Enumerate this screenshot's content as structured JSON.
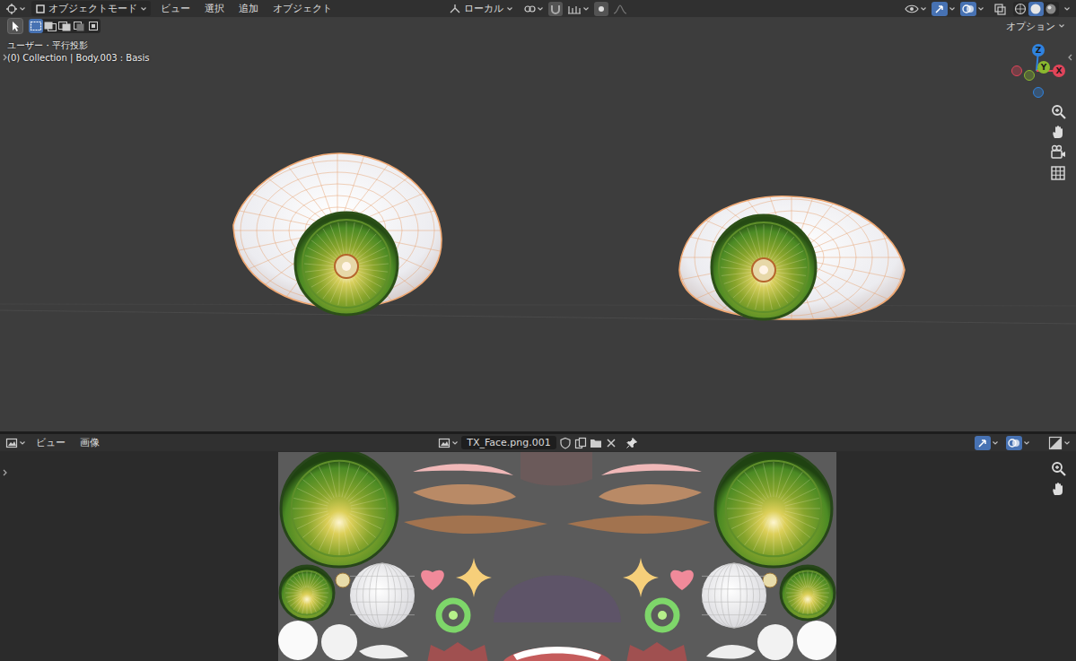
{
  "viewport": {
    "mode": "オブジェクトモード",
    "menus": [
      "ビュー",
      "選択",
      "追加",
      "オブジェクト"
    ],
    "orientation": "ローカル",
    "select_modes": [
      {
        "selected": true
      },
      {
        "selected": false
      },
      {
        "selected": false
      },
      {
        "selected": false
      },
      {
        "selected": false
      }
    ],
    "shading_modes": [
      {
        "selected": false
      },
      {
        "selected": true
      },
      {
        "selected": false
      }
    ],
    "options": "オプション",
    "view_name": "ユーザー・平行投影",
    "object_info": "(0) Collection | Body.003 : Basis",
    "gizmo_axes": [
      {
        "label": "Z",
        "color": "#2f83e0"
      },
      {
        "label": "Y",
        "color": "#8bb82f"
      },
      {
        "label": "X",
        "color": "#e0455a"
      }
    ]
  },
  "image_editor": {
    "menus": [
      "ビュー",
      "画像"
    ],
    "image_name": "TX_Face.png.001"
  }
}
